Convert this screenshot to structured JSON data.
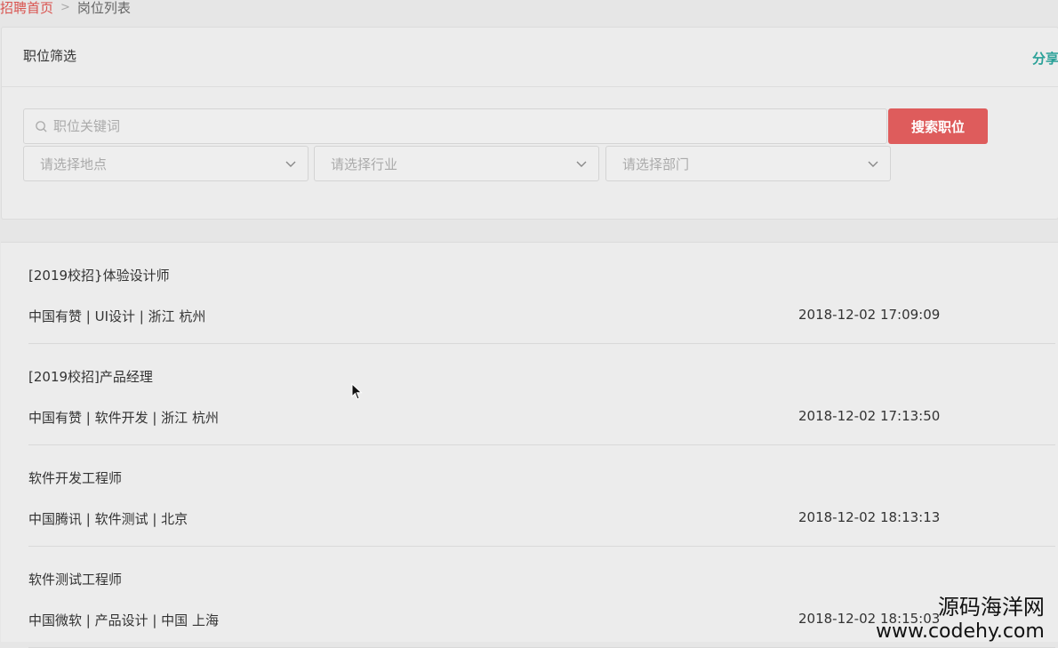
{
  "breadcrumb": {
    "home": "招聘首页",
    "separator": ">",
    "current": "岗位列表"
  },
  "filter": {
    "title": "职位筛选",
    "share": "分享",
    "search_placeholder": "职位关键词",
    "search_button": "搜索职位",
    "location_placeholder": "请选择地点",
    "industry_placeholder": "请选择行业",
    "department_placeholder": "请选择部门"
  },
  "jobs": [
    {
      "title": "[2019校招}体验设计师",
      "meta": "中国有赞 | UI设计 | 浙江 杭州",
      "time": "2018-12-02 17:09:09"
    },
    {
      "title": "[2019校招]产品经理",
      "meta": "中国有赞 | 软件开发 | 浙江 杭州",
      "time": "2018-12-02 17:13:50"
    },
    {
      "title": "软件开发工程师",
      "meta": "中国腾讯 | 软件测试 | 北京",
      "time": "2018-12-02 18:13:13"
    },
    {
      "title": "软件测试工程师",
      "meta": "中国微软 | 产品设计 | 中国 上海",
      "time": "2018-12-02 18:15:03"
    }
  ],
  "watermark": {
    "cn": "源码海洋网",
    "url": "www.codehy.com"
  },
  "colors": {
    "accent_red": "#de5c5c",
    "breadcrumb_home": "#d9534f",
    "share_teal": "#2aa198"
  },
  "icons": [
    "search-icon",
    "chevron-down-icon",
    "mouse-cursor-icon"
  ]
}
